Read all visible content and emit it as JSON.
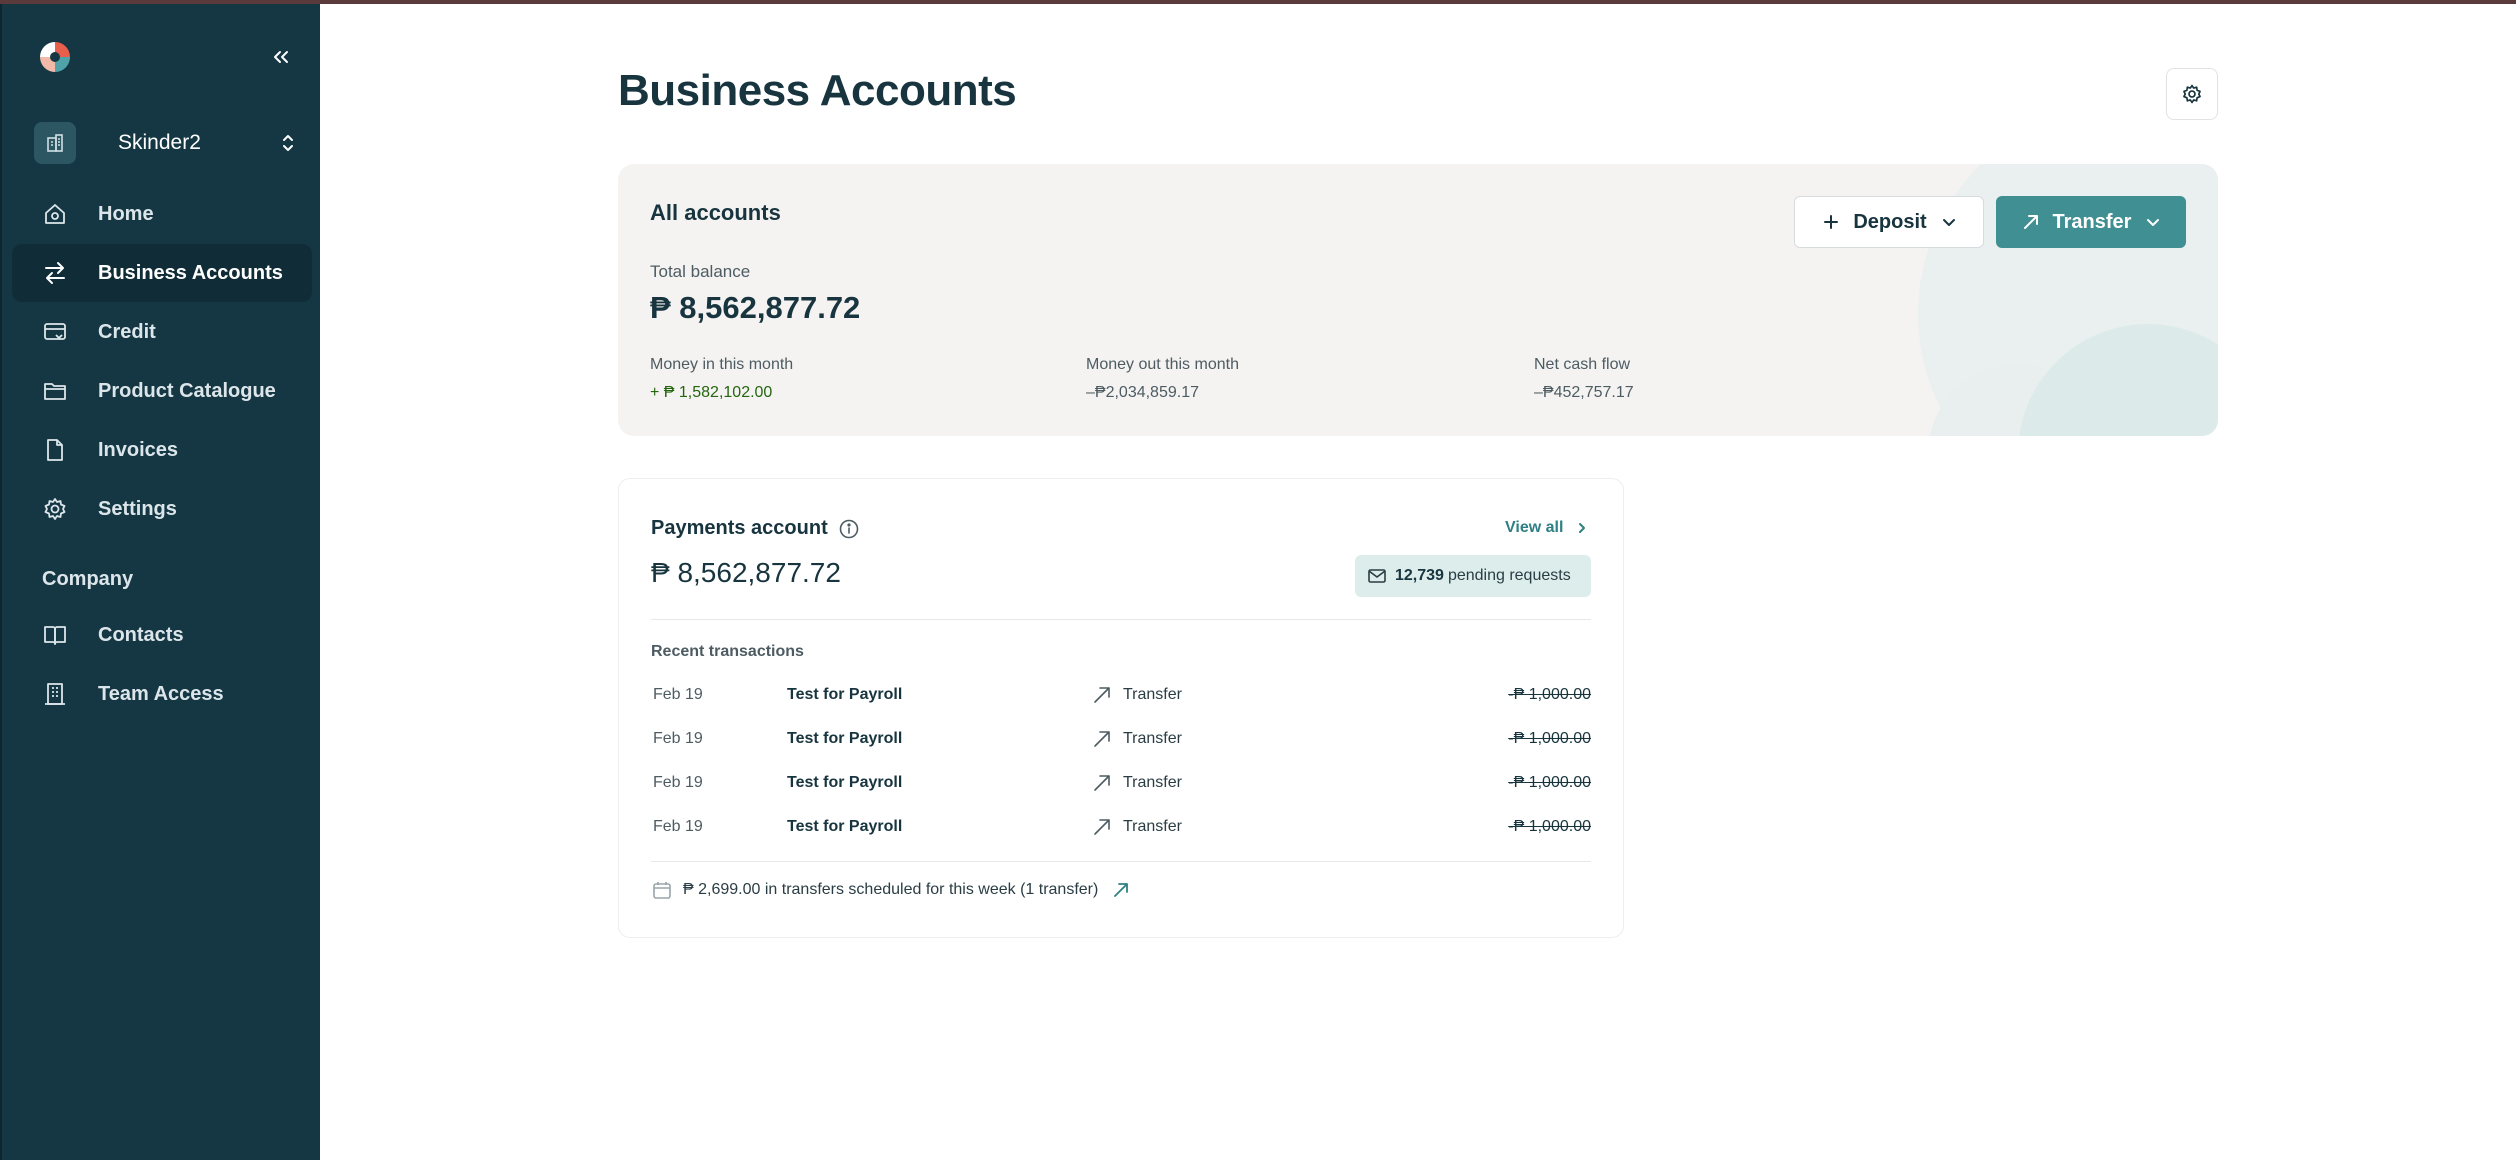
{
  "sidebar": {
    "org_name": "Skinder2",
    "nav": [
      {
        "label": "Home",
        "icon": "home-icon"
      },
      {
        "label": "Business Accounts",
        "icon": "transfer-arrows-icon"
      },
      {
        "label": "Credit",
        "icon": "credit-card-icon"
      },
      {
        "label": "Product Catalogue",
        "icon": "folder-icon"
      },
      {
        "label": "Invoices",
        "icon": "document-icon"
      },
      {
        "label": "Settings",
        "icon": "gear-icon"
      }
    ],
    "company_section": "Company",
    "company_nav": [
      {
        "label": "Contacts",
        "icon": "book-icon"
      },
      {
        "label": "Team Access",
        "icon": "building-icon"
      }
    ]
  },
  "page": {
    "title": "Business Accounts"
  },
  "summary": {
    "title": "All accounts",
    "total_label": "Total balance",
    "total_value": "₱ 8,562,877.72",
    "money_in_label": "Money in this month",
    "money_in_value": "+ ₱ 1,582,102.00",
    "money_out_label": "Money out this month",
    "money_out_value": "–₱2,034,859.17",
    "net_label": "Net cash flow",
    "net_value": "–₱452,757.17",
    "deposit_label": "Deposit",
    "transfer_label": "Transfer"
  },
  "payments": {
    "title": "Payments account",
    "view_all": "View all",
    "balance": "₱ 8,562,877.72",
    "pending_count": "12,739",
    "pending_text": "pending requests",
    "recent_label": "Recent transactions",
    "transactions": [
      {
        "date": "Feb 19",
        "description": "Test for Payroll",
        "type": "Transfer",
        "amount": "-₱ 1,000.00"
      },
      {
        "date": "Feb 19",
        "description": "Test for Payroll",
        "type": "Transfer",
        "amount": "-₱ 1,000.00"
      },
      {
        "date": "Feb 19",
        "description": "Test for Payroll",
        "type": "Transfer",
        "amount": "-₱ 1,000.00"
      },
      {
        "date": "Feb 19",
        "description": "Test for Payroll",
        "type": "Transfer",
        "amount": "-₱ 1,000.00"
      }
    ],
    "scheduled_text": "₱ 2,699.00 in transfers scheduled for this week (1 transfer)"
  },
  "colors": {
    "sidebar_bg": "#153744",
    "accent": "#3f8f93",
    "positive": "#24660f"
  }
}
